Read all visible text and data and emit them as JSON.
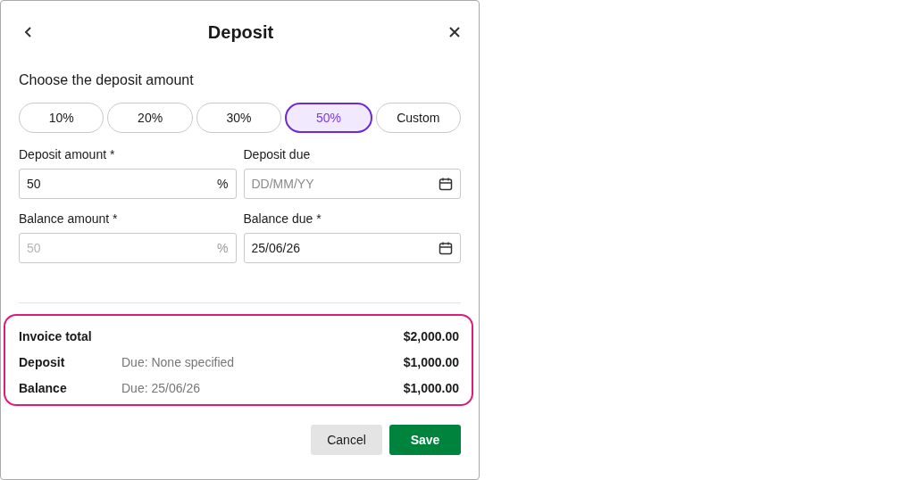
{
  "dialog": {
    "title": "Deposit"
  },
  "section_title": "Choose the deposit amount",
  "presets": [
    {
      "label": "10%",
      "selected": false
    },
    {
      "label": "20%",
      "selected": false
    },
    {
      "label": "30%",
      "selected": false
    },
    {
      "label": "50%",
      "selected": true
    },
    {
      "label": "Custom",
      "selected": false
    }
  ],
  "fields": [
    {
      "label": "Deposit amount *",
      "kind": "amount",
      "value": "50",
      "suffix": "%",
      "disabled": false
    },
    {
      "label": "Deposit due",
      "kind": "date",
      "placeholder": "DD/MM/YY",
      "disabled": false
    },
    {
      "label": "Balance amount *",
      "kind": "amount",
      "value": "50",
      "suffix": "%",
      "disabled": true
    },
    {
      "label": "Balance due *",
      "kind": "date",
      "value": "25/06/26",
      "disabled": false
    }
  ],
  "summary": [
    {
      "label": "Invoice total",
      "amount": "$2,000.00"
    },
    {
      "label": "Deposit",
      "note": "Due: None specified",
      "amount": "$1,000.00"
    },
    {
      "label": "Balance",
      "note": "Due: 25/06/26",
      "amount": "$1,000.00"
    }
  ],
  "buttons": [
    {
      "label": "Cancel",
      "kind": "secondary"
    },
    {
      "label": "Save",
      "kind": "primary"
    }
  ]
}
